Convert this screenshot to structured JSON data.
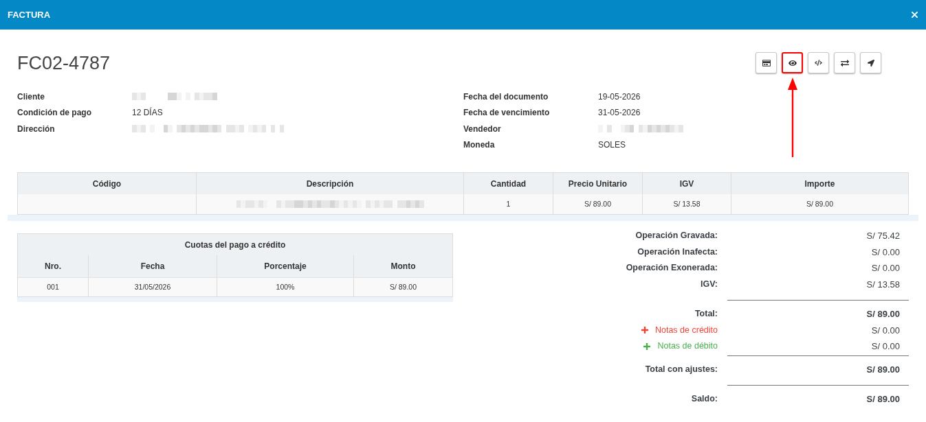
{
  "window": {
    "title": "FACTURA"
  },
  "document": {
    "number": "FC02-4787"
  },
  "toolbar": [
    {
      "kind": "card",
      "highlighted": false
    },
    {
      "kind": "view",
      "highlighted": true
    },
    {
      "kind": "code",
      "highlighted": false
    },
    {
      "kind": "exchange",
      "highlighted": false
    },
    {
      "kind": "send",
      "highlighted": false
    }
  ],
  "details_left": [
    {
      "label": "Cliente",
      "redacted": true
    },
    {
      "label": "Condición de pago",
      "value": "12 DÍAS",
      "redacted": false
    },
    {
      "label": "Dirección",
      "redacted": true
    }
  ],
  "details_right": [
    {
      "label": "Fecha del documento",
      "value": "19-05-2026",
      "redacted": false
    },
    {
      "label": "Fecha de vencimiento",
      "value": "31-05-2026",
      "redacted": false
    },
    {
      "label": "Vendedor",
      "redacted": true
    },
    {
      "label": "Moneda",
      "value": "SOLES",
      "redacted": false
    }
  ],
  "items_table": {
    "columns": [
      "Código",
      "Descripción",
      "Cantidad",
      "Precio Unitario",
      "IGV",
      "Importe"
    ],
    "rows": [
      {
        "cells": [
          {
            "kind": "blank"
          },
          {
            "kind": "redacted"
          },
          {
            "kind": "text",
            "text": "1"
          },
          {
            "kind": "text",
            "text": "S/ 89.00"
          },
          {
            "kind": "text",
            "text": "S/ 13.58"
          },
          {
            "kind": "text",
            "text": "S/ 89.00"
          }
        ]
      }
    ]
  },
  "installments": {
    "title": "Cuotas del pago a crédito",
    "columns": [
      "Nro.",
      "Fecha",
      "Porcentaje",
      "Monto"
    ],
    "rows": [
      [
        "001",
        "31/05/2026",
        "100%",
        "S/ 89.00"
      ]
    ]
  },
  "totals": [
    {
      "kind": "amount",
      "label": "Operación Gravada:",
      "value": "S/ 75.42"
    },
    {
      "kind": "amount",
      "label": "Operación Inafecta:",
      "value": "S/ 0.00"
    },
    {
      "kind": "amount",
      "label": "Operación Exonerada:",
      "value": "S/ 0.00"
    },
    {
      "kind": "amount",
      "label": "IGV:",
      "value": "S/ 13.58"
    },
    {
      "kind": "total",
      "label": "Total:",
      "value": "S/ 89.00"
    },
    {
      "kind": "note",
      "label": "Notas de crédito",
      "value": "S/ 0.00",
      "color": "#f44336"
    },
    {
      "kind": "note",
      "label": "Notas de débito",
      "value": "S/ 0.00",
      "color": "#4caf50"
    },
    {
      "kind": "total",
      "label": "Total con ajustes:",
      "value": "S/ 89.00"
    },
    {
      "kind": "total",
      "label": "Saldo:",
      "value": "S/ 89.00"
    }
  ]
}
